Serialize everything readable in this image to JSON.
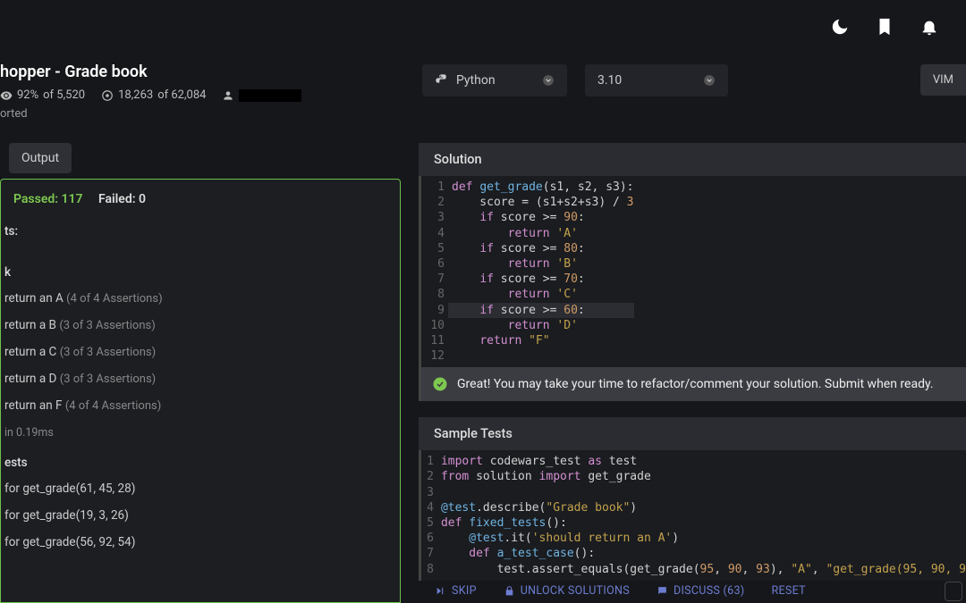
{
  "header": {
    "title": "hopper - Grade book",
    "satisfaction_pct": "92%",
    "satisfaction_of": "of 5,520",
    "completions": "18,263",
    "completions_of": "of 62,084",
    "reported_label": "orted"
  },
  "topbar": {
    "moon_icon": "moon-icon",
    "bookmark_icon": "bookmark-icon",
    "bell_icon": "bell-icon"
  },
  "selectors": {
    "language": "Python",
    "version": "3.10",
    "editor_mode": "VIM"
  },
  "tabs": {
    "output": "Output"
  },
  "results": {
    "passed_label": "Passed:",
    "passed_count": "117",
    "failed_label": "Failed:",
    "failed_count": "0",
    "section1": "ts:",
    "section2": "k",
    "tests": [
      {
        "label": "return an A",
        "note": "(4 of 4 Assertions)"
      },
      {
        "label": "return a B",
        "note": "(3 of 3 Assertions)"
      },
      {
        "label": "return a C",
        "note": "(3 of 3 Assertions)"
      },
      {
        "label": "return a D",
        "note": "(3 of 3 Assertions)"
      },
      {
        "label": "return an F",
        "note": "(4 of 4 Assertions)"
      }
    ],
    "timing": "in 0.19ms",
    "section3": "ests",
    "randoms": [
      "for get_grade(61, 45, 28)",
      "for get_grade(19, 3, 26)",
      "for get_grade(56, 92, 54)"
    ]
  },
  "solution": {
    "header": "Solution",
    "lines": [
      {
        "n": 1,
        "html": "<span class='kw'>def</span> <span class='fn'>get_grade</span>(s1, s2, s3):"
      },
      {
        "n": 2,
        "html": "    score = (s1+s2+s3) / <span class='num'>3</span>"
      },
      {
        "n": 3,
        "html": "    <span class='kw'>if</span> score &gt;= <span class='num'>90</span>:"
      },
      {
        "n": 4,
        "html": "        <span class='kw'>return</span> <span class='str'>'A'</span>"
      },
      {
        "n": 5,
        "html": "    <span class='kw'>if</span> score &gt;= <span class='num'>80</span>:"
      },
      {
        "n": 6,
        "html": "        <span class='kw'>return</span> <span class='str'>'B'</span>"
      },
      {
        "n": 7,
        "html": "    <span class='kw'>if</span> score &gt;= <span class='num'>70</span>:"
      },
      {
        "n": 8,
        "html": "        <span class='kw'>return</span> <span class='str'>'C'</span>"
      },
      {
        "n": 9,
        "html": "    <span class='kw'>if</span> score &gt;= <span class='num'>60</span>:",
        "hl": true
      },
      {
        "n": 10,
        "html": "        <span class='kw'>return</span> <span class='str'>'D'</span>"
      },
      {
        "n": 11,
        "html": "    <span class='kw'>return</span> <span class='str'>\"F\"</span>"
      },
      {
        "n": 12,
        "html": ""
      }
    ]
  },
  "banner": {
    "text": "Great! You may take your time to refactor/comment your solution. Submit when ready."
  },
  "sample_tests": {
    "header": "Sample Tests",
    "lines": [
      {
        "n": 1,
        "html": "<span class='kw'>import</span> codewars_test <span class='kw'>as</span> test"
      },
      {
        "n": 2,
        "html": "<span class='kw'>from</span> solution <span class='kw'>import</span> get_grade"
      },
      {
        "n": 3,
        "html": ""
      },
      {
        "n": 4,
        "html": "<span class='dec'>@test</span>.describe(<span class='str'>\"Grade book\"</span>)"
      },
      {
        "n": 5,
        "html": "<span class='kw'>def</span> <span class='fn'>fixed_tests</span>():"
      },
      {
        "n": 6,
        "html": "    <span class='dec'>@test</span>.it(<span class='str'>'should return an A'</span>)"
      },
      {
        "n": 7,
        "html": "    <span class='kw'>def</span> <span class='fn'>a_test_case</span>():"
      },
      {
        "n": 8,
        "html": "        test.assert_equals(get_grade(<span class='num'>95</span>, <span class='num'>90</span>, <span class='num'>93</span>), <span class='str'>\"A\"</span>, <span class='str'>\"get_grade(95, 90, 9</span>"
      }
    ]
  },
  "actions": {
    "skip": "SKIP",
    "unlock": "UNLOCK SOLUTIONS",
    "discuss": "DISCUSS (63)",
    "reset": "RESET"
  }
}
